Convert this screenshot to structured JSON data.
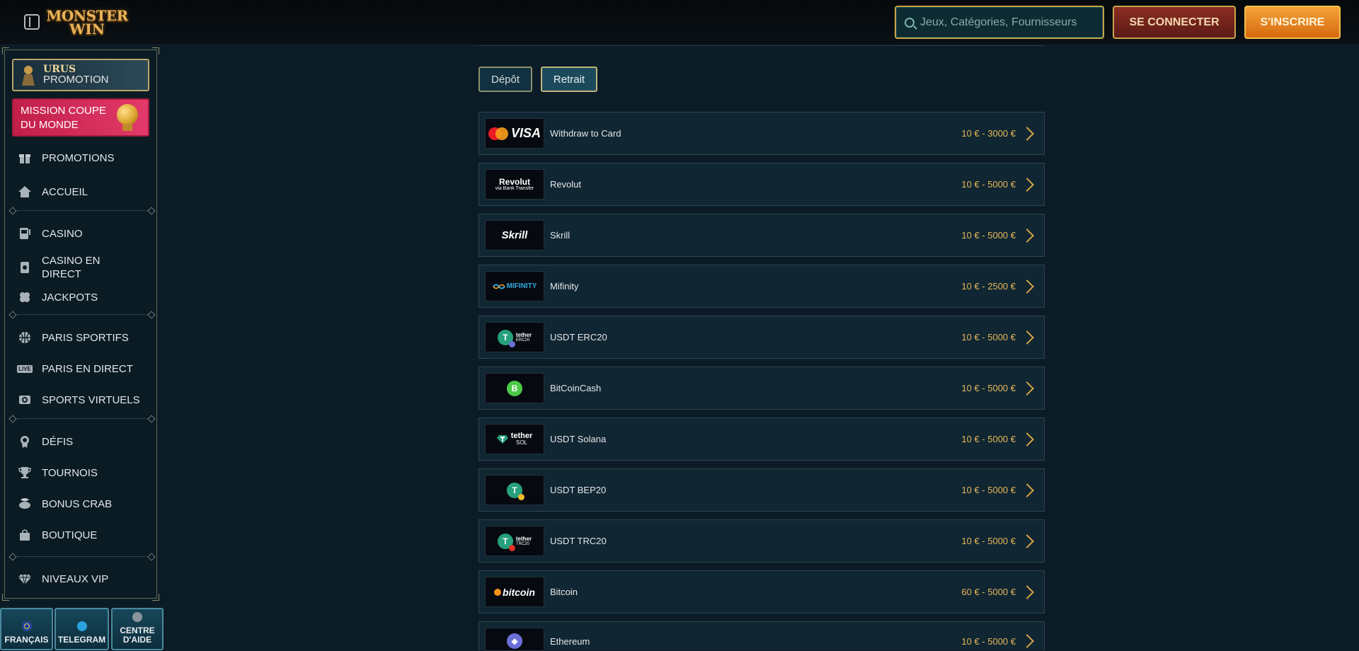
{
  "header": {
    "logo_line1": "MONSTER",
    "logo_line2": "WIN",
    "search_placeholder": "Jeux, Catégories, Fournisseurs",
    "login_label": "SE CONNECTER",
    "signup_label": "S'INSCRIRE"
  },
  "sidebar": {
    "promo_card": {
      "title": "URUS",
      "subtitle": "PROMOTION"
    },
    "mission_card": {
      "label": "MISSION COUPE DU MONDE"
    },
    "items": [
      {
        "label": "PROMOTIONS",
        "icon": "gift-icon"
      },
      {
        "label": "ACCUEIL",
        "icon": "home-icon"
      },
      {
        "label": "CASINO",
        "icon": "slot-machine-icon"
      },
      {
        "label": "CASINO EN DIRECT",
        "icon": "cards-icon"
      },
      {
        "label": "JACKPOTS",
        "icon": "clover-icon"
      },
      {
        "label": "PARIS SPORTIFS",
        "icon": "basketball-icon"
      },
      {
        "label": "PARIS EN DIRECT",
        "icon": "live-icon",
        "badge": "LIVE"
      },
      {
        "label": "SPORTS VIRTUELS",
        "icon": "virtual-sports-icon"
      },
      {
        "label": "DÉFIS",
        "icon": "medal-icon"
      },
      {
        "label": "TOURNOIS",
        "icon": "trophy-icon"
      },
      {
        "label": "BONUS CRAB",
        "icon": "crab-icon"
      },
      {
        "label": "BOUTIQUE",
        "icon": "shop-bag-icon"
      },
      {
        "label": "NIVEAUX VIP",
        "icon": "diamond-icon"
      }
    ],
    "footer": [
      {
        "label": "FRANÇAIS",
        "icon": "eu-flag-icon"
      },
      {
        "label": "TELEGRAM",
        "icon": "telegram-icon"
      },
      {
        "label": "CENTRE D'AIDE",
        "icon": "help-icon"
      }
    ]
  },
  "tabs": [
    {
      "label": "Dépôt",
      "active": false
    },
    {
      "label": "Retrait",
      "active": true
    }
  ],
  "methods": [
    {
      "name": "Withdraw to Card",
      "limit": "10 € - 3000 €",
      "logo": "visa-mastercard"
    },
    {
      "name": "Revolut",
      "limit": "10 € - 5000 €",
      "logo": "revolut",
      "logo_text": "Revolut",
      "logo_sub": "via Bank Transfer"
    },
    {
      "name": "Skrill",
      "limit": "10 € - 5000 €",
      "logo": "skrill",
      "logo_text": "Skrill"
    },
    {
      "name": "Mifinity",
      "limit": "10 € - 2500 €",
      "logo": "mifinity",
      "logo_text": "MIFINITY"
    },
    {
      "name": "USDT ERC20",
      "limit": "10 € - 5000 €",
      "logo": "tether",
      "logo_text": "tether",
      "logo_sub": "ERC20",
      "badge_color": "#6b6fd8"
    },
    {
      "name": "BitCoinCash",
      "limit": "10 € - 5000 €",
      "logo": "bch"
    },
    {
      "name": "USDT Solana",
      "limit": "10 € - 5000 €",
      "logo": "tether-sol",
      "logo_text": "tether",
      "logo_sub": "SOL"
    },
    {
      "name": "USDT BEP20",
      "limit": "10 € - 5000 €",
      "logo": "tether-bep",
      "badge_color": "#f3ba2f"
    },
    {
      "name": "USDT TRC20",
      "limit": "10 € - 5000 €",
      "logo": "tether",
      "logo_text": "tether",
      "logo_sub": "TRC20",
      "badge_color": "#e5322d"
    },
    {
      "name": "Bitcoin",
      "limit": "60 € - 5000 €",
      "logo": "bitcoin",
      "logo_text": "bitcoin"
    },
    {
      "name": "Ethereum",
      "limit": "10 € - 5000 €",
      "logo": "eth"
    }
  ]
}
